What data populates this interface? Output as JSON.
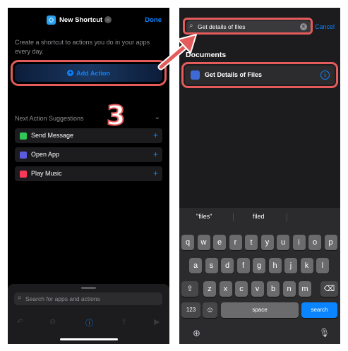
{
  "left": {
    "nav": {
      "title": "New Shortcut",
      "done": "Done"
    },
    "description": "Create a shortcut to actions you do in your apps every day.",
    "add_action": "Add Action",
    "step": "3",
    "suggestions_header": "Next Action Suggestions",
    "suggestions": [
      {
        "label": "Send Message",
        "color": "#30c758"
      },
      {
        "label": "Open App",
        "color": "#5a5ce0"
      },
      {
        "label": "Play Music",
        "color": "#fb3a5a"
      }
    ],
    "search_placeholder": "Search for apps and actions"
  },
  "right": {
    "search_value": "Get details of files",
    "cancel": "Cancel",
    "section": "Documents",
    "result": "Get Details of Files",
    "predictions": [
      "\"files\"",
      "filed",
      ""
    ],
    "rows": [
      [
        "q",
        "w",
        "e",
        "r",
        "t",
        "y",
        "u",
        "i",
        "o",
        "p"
      ],
      [
        "a",
        "s",
        "d",
        "f",
        "g",
        "h",
        "j",
        "k",
        "l"
      ],
      [
        "z",
        "x",
        "c",
        "v",
        "b",
        "n",
        "m"
      ]
    ],
    "key_123": "123",
    "key_space": "space",
    "key_search": "search"
  },
  "colors": {
    "accent": "#0a84ff",
    "highlight": "#e45b5b"
  }
}
